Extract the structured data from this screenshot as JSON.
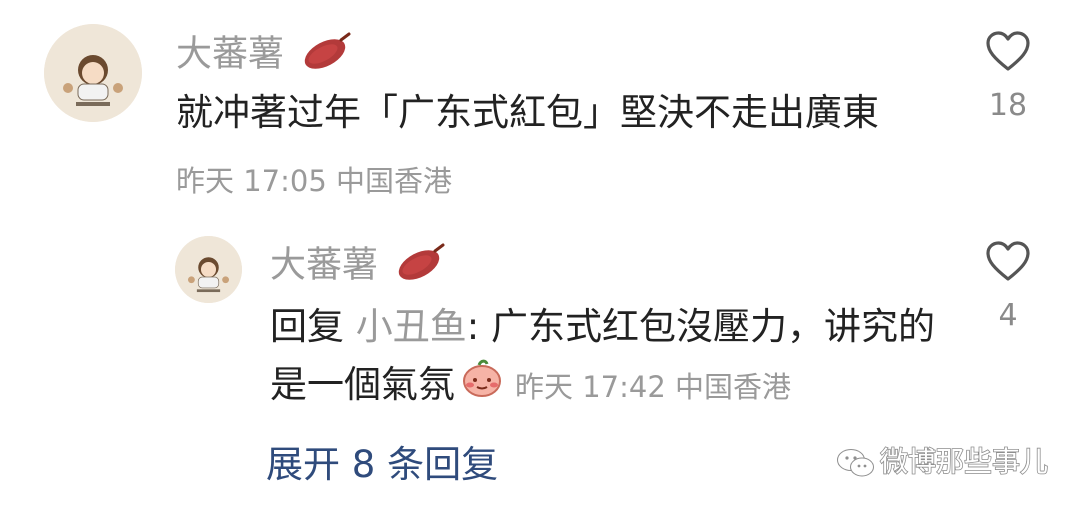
{
  "comment": {
    "username": "大蕃薯",
    "text": "就冲著过年「广东式紅包」堅決不走出廣東",
    "meta": "昨天 17:05 中国香港",
    "likes": "18"
  },
  "reply": {
    "username": "大蕃薯",
    "prefix": "回复",
    "target": "小丑鱼",
    "text": ": 广东式红包沒壓力，讲究的是一個氣氛",
    "meta": "昨天 17:42 中国香港",
    "likes": "4"
  },
  "expand_label": "展开 8 条回复",
  "watermark": "微博那些事儿",
  "colors": {
    "username": "#9a9a9a",
    "text": "#222222",
    "link": "#2f4b7c",
    "like_icon": "#555555"
  },
  "icons": {
    "like": "heart-outline-icon",
    "username_badge": "sweet-potato-icon",
    "emoji": "shy-face-emoji",
    "watermark": "wechat-icon"
  }
}
